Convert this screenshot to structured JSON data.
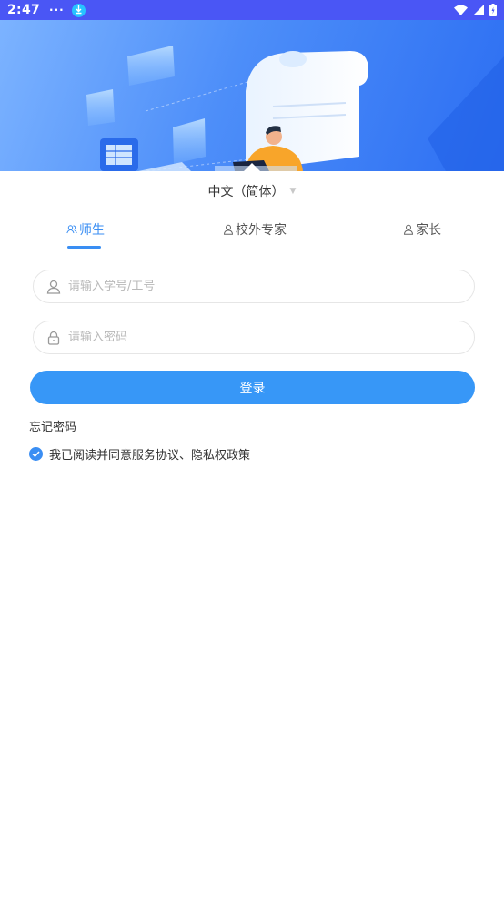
{
  "status_bar": {
    "time": "2:47",
    "dots": "···"
  },
  "language": {
    "selected": "中文（简体）"
  },
  "tabs": [
    {
      "label": "师生",
      "active": true
    },
    {
      "label": "校外专家",
      "active": false
    },
    {
      "label": "家长",
      "active": false
    }
  ],
  "form": {
    "account_placeholder": "请输入学号/工号",
    "account_value": "",
    "password_placeholder": "请输入密码",
    "password_value": "",
    "login_label": "登录",
    "forgot_label": "忘记密码",
    "agreement_text": "我已阅读并同意服务协议、隐私权政策",
    "agreement_checked": true
  },
  "colors": {
    "status_bar": "#4a56f5",
    "accent": "#3a8ef3",
    "button": "#3797f7"
  }
}
